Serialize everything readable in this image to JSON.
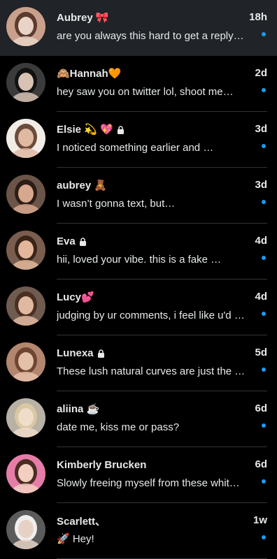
{
  "conversations": [
    {
      "name": "Aubrey 🎀",
      "time": "18h",
      "preview": "are you always this hard to get a reply…",
      "unread": true,
      "locked": false,
      "avatar": {
        "bg": "#c9a08c",
        "fg": "#e9d3c6",
        "hair": "#5a3b2d"
      }
    },
    {
      "name": "🙈Hannah🧡",
      "time": "2d",
      "preview": "hey saw you on twitter lol, shoot me…",
      "unread": true,
      "locked": false,
      "avatar": {
        "bg": "#3b3b3b",
        "fg": "#d7c2b4",
        "hair": "#121212"
      }
    },
    {
      "name": "Elsie 💫 💖",
      "time": "3d",
      "preview": "I noticed something earlier and …",
      "unread": true,
      "locked": true,
      "avatar": {
        "bg": "#f2ece7",
        "fg": "#e0b9a3",
        "hair": "#6b4b39"
      }
    },
    {
      "name": "aubrey 🧸",
      "time": "3d",
      "preview": "I wasn’t gonna text, but…",
      "unread": true,
      "locked": false,
      "avatar": {
        "bg": "#6b5448",
        "fg": "#d7a88e",
        "hair": "#2b1d16"
      }
    },
    {
      "name": "Eva",
      "time": "4d",
      "preview": "hii, loved your vibe. this is a fake …",
      "unread": true,
      "locked": true,
      "avatar": {
        "bg": "#7a5d4e",
        "fg": "#e2b79b",
        "hair": "#3a2418"
      }
    },
    {
      "name": "Lucy💕",
      "time": "4d",
      "preview": "judging by ur comments, i feel like u'd …",
      "unread": true,
      "locked": false,
      "avatar": {
        "bg": "#705b50",
        "fg": "#e0b9a0",
        "hair": "#4a2f22"
      }
    },
    {
      "name": "Lunexa",
      "time": "5d",
      "preview": "These lush natural curves are just the …",
      "unread": true,
      "locked": true,
      "avatar": {
        "bg": "#b38670",
        "fg": "#e5c0a8",
        "hair": "#6e4432"
      }
    },
    {
      "name": "aliina ☕",
      "time": "6d",
      "preview": "date me, kiss me or pass?",
      "unread": true,
      "locked": false,
      "avatar": {
        "bg": "#b8b1a5",
        "fg": "#efdcc9",
        "hair": "#d9c7a3"
      }
    },
    {
      "name": "Kimberly Brucken",
      "time": "6d",
      "preview": "Slowly freeing myself from these whit…",
      "unread": true,
      "locked": false,
      "avatar": {
        "bg": "#e57da8",
        "fg": "#f2cfc1",
        "hair": "#4b2c20"
      }
    },
    {
      "name": "Scarlett、",
      "time": "1w",
      "preview": "🚀 Hey!",
      "unread": true,
      "locked": false,
      "avatar": {
        "bg": "#5b5b5b",
        "fg": "#e6d2c4",
        "hair": "#eeeeee"
      }
    }
  ],
  "colors": {
    "unread_dot": "#1d9bf0",
    "selected_row": "#202327",
    "divider": "#2f3336"
  }
}
